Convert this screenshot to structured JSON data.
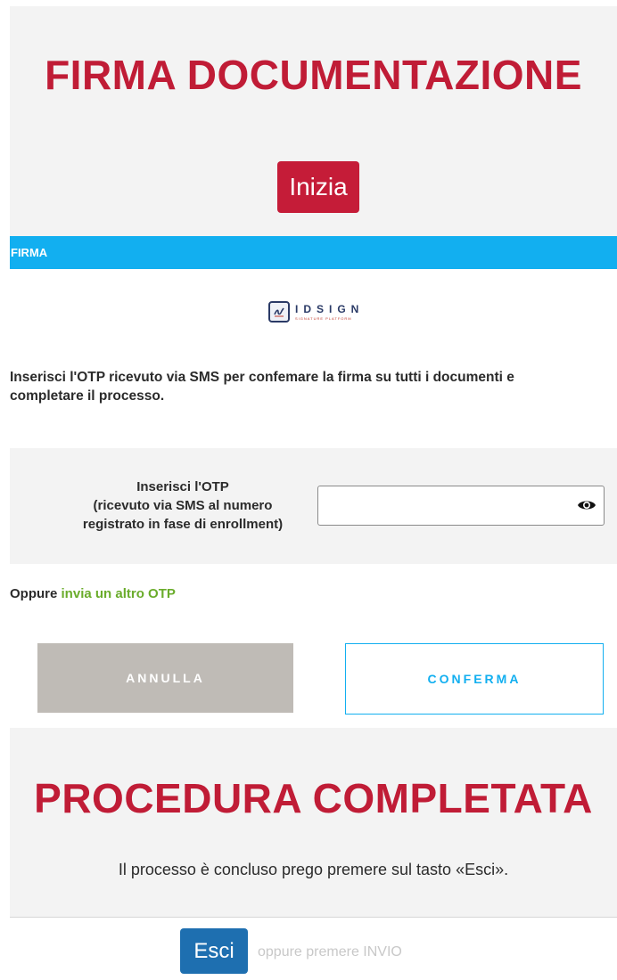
{
  "header": {
    "title": "FIRMA DOCUMENTAZIONE",
    "start_button": "Inizia"
  },
  "section_bar": {
    "label": "FIRMA"
  },
  "logo": {
    "name": "IDSIGN",
    "tagline": "SIGNATURE PLATFORM"
  },
  "instructions": {
    "line1": "Inserisci l'OTP ricevuto via SMS per confemare la firma su tutti i documenti e",
    "line2": "completare il processo."
  },
  "otp": {
    "label_line1": "Inserisci l'OTP",
    "label_line2": "(ricevuto via SMS al numero",
    "label_line3": "registrato in fase di enrollment)",
    "value": "",
    "placeholder": ""
  },
  "resend": {
    "prefix": "Oppure",
    "link": "invia un altro OTP"
  },
  "actions": {
    "cancel": "ANNULLA",
    "confirm": "CONFERMA"
  },
  "completion": {
    "title": "PROCEDURA COMPLETATA",
    "message": "Il processo è concluso prego premere sul tasto «Esci».",
    "exit_button": "Esci",
    "exit_hint": "oppure premere INVIO"
  },
  "colors": {
    "accent_red": "#c51c38",
    "accent_blue": "#12aff0",
    "link_green": "#6aac2b",
    "exit_blue": "#1e6fb0"
  }
}
